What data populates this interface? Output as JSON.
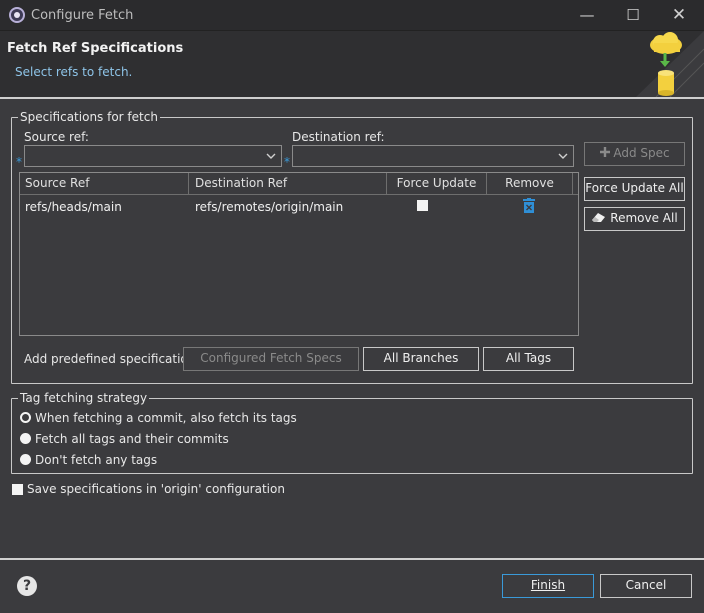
{
  "window": {
    "title": "Configure Fetch",
    "minimize": "—",
    "maximize": "☐",
    "close": "✕"
  },
  "header": {
    "title": "Fetch Ref Specifications",
    "subtitle": "Select refs to fetch."
  },
  "specs_group": {
    "legend": "Specifications for fetch",
    "source_label": "Source ref:",
    "destination_label": "Destination ref:",
    "source_value": "",
    "destination_value": "",
    "add_spec": "Add Spec",
    "force_update_all": "Force Update All",
    "remove_all": "Remove All",
    "table": {
      "columns": [
        "Source Ref",
        "Destination Ref",
        "Force Update",
        "Remove"
      ],
      "rows": [
        {
          "source": "refs/heads/main",
          "destination": "refs/remotes/origin/main",
          "force_update": false
        }
      ]
    },
    "predefined_label": "Add predefined specification",
    "configured_fetch_specs": "Configured Fetch Specs",
    "all_branches": "All Branches",
    "all_tags": "All Tags"
  },
  "tag_group": {
    "legend": "Tag fetching strategy",
    "options": [
      {
        "label": "When fetching a commit, also fetch its tags",
        "selected": true
      },
      {
        "label": "Fetch all tags and their commits",
        "selected": false
      },
      {
        "label": "Don't fetch any tags",
        "selected": false
      }
    ]
  },
  "save_specs": {
    "label": "Save specifications in 'origin' configuration",
    "checked": false
  },
  "footer": {
    "help": "?",
    "finish": "Finish",
    "cancel": "Cancel"
  },
  "icons": {
    "app": "eclipse-gear-icon",
    "banner": "cloud-fetch-database-icon",
    "add": "plus-icon",
    "remove_all": "eraser-icon",
    "remove_row": "trash-icon",
    "help": "help-icon"
  },
  "colors": {
    "accent": "#3a9ad9",
    "background": "#3b3b3e"
  }
}
